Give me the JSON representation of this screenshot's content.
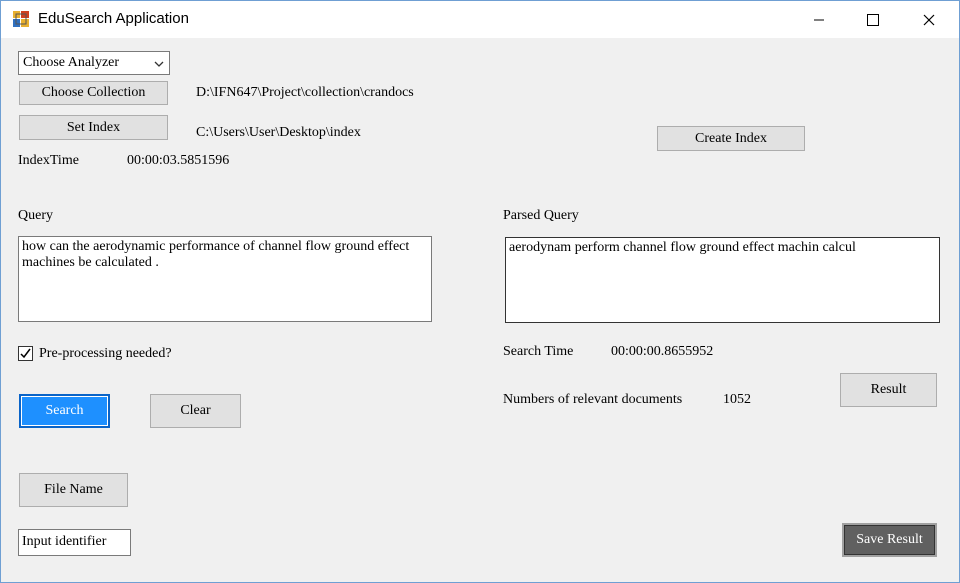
{
  "window": {
    "title": "EduSearch Application"
  },
  "controls": {
    "analyzer_select": "Choose Analyzer",
    "choose_collection_label": "Choose Collection",
    "collection_path": "D:\\IFN647\\Project\\collection\\crandocs",
    "set_index_label": "Set Index",
    "index_path": "C:\\Users\\User\\Desktop\\index",
    "create_index_label": "Create Index",
    "index_time_label": "IndexTime",
    "index_time_value": "00:00:03.5851596"
  },
  "query": {
    "label": "Query",
    "value": "how can the aerodynamic performance of channel flow ground effect machines be calculated .",
    "parsed_label": "Parsed Query",
    "parsed_value": "aerodynam perform channel flow ground effect machin calcul",
    "preprocessing_label": "Pre-processing needed?",
    "preprocessing_checked": true
  },
  "search": {
    "search_label": "Search",
    "clear_label": "Clear",
    "search_time_label": "Search Time",
    "search_time_value": "00:00:00.8655952",
    "relevant_label": "Numbers of relevant documents",
    "relevant_count": "1052",
    "result_label": "Result"
  },
  "output": {
    "file_name_label": "File Name",
    "identifier_value": "Input identifier",
    "save_result_label": "Save Result"
  },
  "colors": {
    "accent": "#1e90ff",
    "window_bg": "#f0f0f0",
    "save_button_bg": "#606060"
  }
}
